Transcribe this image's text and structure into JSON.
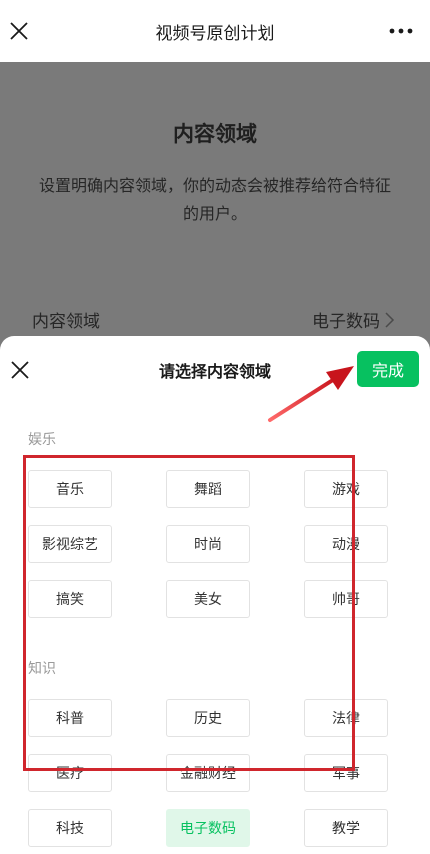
{
  "header": {
    "title": "视频号原创计划",
    "close_icon": "close-icon",
    "more_icon": "more-icon"
  },
  "behind": {
    "title": "内容领域",
    "description": "设置明确内容领域，你的动态会被推荐给符合特征的用户。",
    "row_label": "内容领域",
    "row_value": "电子数码"
  },
  "sheet": {
    "title": "请选择内容领域",
    "done_label": "完成",
    "sections": [
      {
        "label": "娱乐",
        "tags": [
          "音乐",
          "舞蹈",
          "游戏",
          "影视综艺",
          "时尚",
          "动漫",
          "搞笑",
          "美女",
          "帅哥"
        ]
      },
      {
        "label": "知识",
        "tags": [
          "科普",
          "历史",
          "法律",
          "医疗",
          "金融财经",
          "军事",
          "科技",
          "电子数码",
          "教学"
        ]
      }
    ],
    "selected_tag": "电子数码"
  },
  "colors": {
    "accent": "#07c160",
    "selected_bg": "#e0f7e9",
    "annotation": "#d0262d",
    "overlay": "#7a7a7a"
  }
}
